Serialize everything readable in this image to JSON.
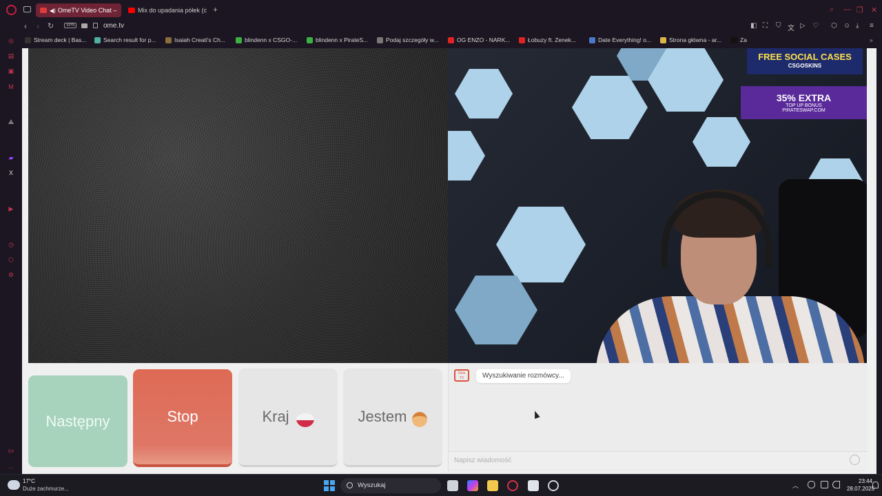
{
  "browser": {
    "tabs": [
      {
        "label": "OmeTV Video Chat –",
        "active": true
      },
      {
        "label": "Mix do upadania półek (c",
        "active": false
      }
    ],
    "new_tab": "+",
    "address": "ome.tv",
    "vpn_label": "VPN"
  },
  "bookmarks": [
    {
      "label": "Stream deck | Bas...",
      "color": "#333333"
    },
    {
      "label": "Search result for p...",
      "color": "#4fb0a3"
    },
    {
      "label": "Isaiah Creati's Ch...",
      "color": "#8a6d3b"
    },
    {
      "label": "blindenn x CSGO-...",
      "color": "#3cb043"
    },
    {
      "label": "blindenn x PirateS...",
      "color": "#3cb043"
    },
    {
      "label": "Podaj szczegóły w...",
      "color": "#777777"
    },
    {
      "label": "OG ENZO - NARK...",
      "color": "#e02424"
    },
    {
      "label": "Łobuzy ft. Zenek...",
      "color": "#e02424"
    },
    {
      "label": "Date Everything! o...",
      "color": "#4a78c7"
    },
    {
      "label": "Strona główna - ar...",
      "color": "#d9b54a"
    },
    {
      "label": "Za",
      "color": "#111111"
    }
  ],
  "ads": {
    "top": {
      "title": "FREE SOCIAL CASES",
      "brand": "CSG✪SKINS"
    },
    "second": {
      "title": "35% EXTRA",
      "subtitle": "TOP UP BONUS",
      "brand": "PIRATESWAP.COM"
    }
  },
  "controls": {
    "next": "Następny",
    "stop": "Stop",
    "country": "Kraj",
    "iam": "Jestem"
  },
  "chat": {
    "logo": "Ome TV",
    "status": "Wyszukiwanie rozmówcy...",
    "placeholder": "Napisz wiadomość"
  },
  "taskbar": {
    "temperature": "17°C",
    "weather": "Duże zachmurze...",
    "search": "Wyszukaj",
    "time": "23:44",
    "date": "28.07.2025"
  },
  "colors": {
    "accent": "#c6203f",
    "next_button": "#a7d3bc",
    "stop_button": "#dd6a55"
  }
}
